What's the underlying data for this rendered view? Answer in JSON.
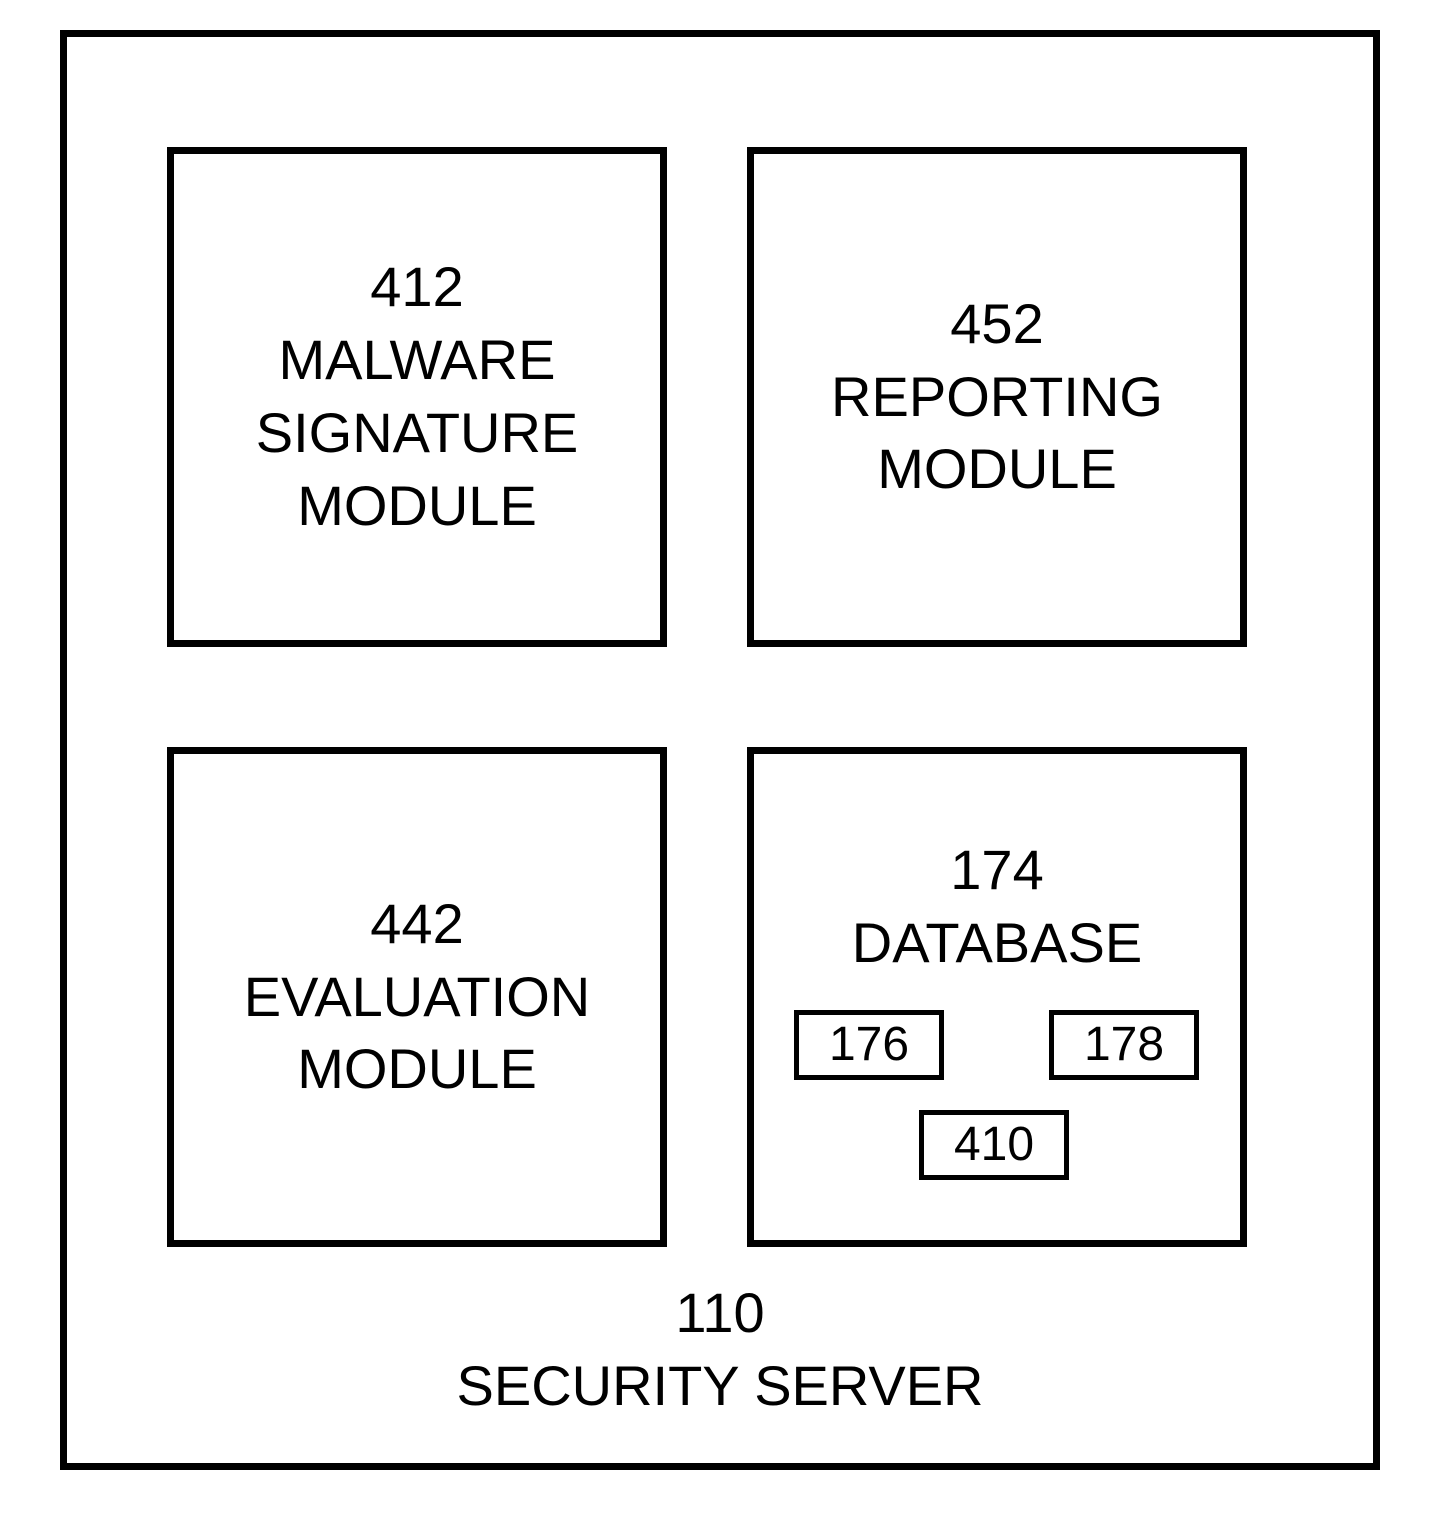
{
  "diagram": {
    "container": {
      "number": "110",
      "label": "SECURITY SERVER"
    },
    "modules": {
      "malware_signature": {
        "number": "412",
        "line1": "MALWARE",
        "line2": "SIGNATURE",
        "line3": "MODULE"
      },
      "reporting": {
        "number": "452",
        "line1": "REPORTING",
        "line2": "MODULE"
      },
      "evaluation": {
        "number": "442",
        "line1": "EVALUATION",
        "line2": "MODULE"
      },
      "database": {
        "number": "174",
        "line1": "DATABASE",
        "sub_boxes": {
          "box1": "176",
          "box2": "178",
          "box3": "410"
        }
      }
    }
  }
}
